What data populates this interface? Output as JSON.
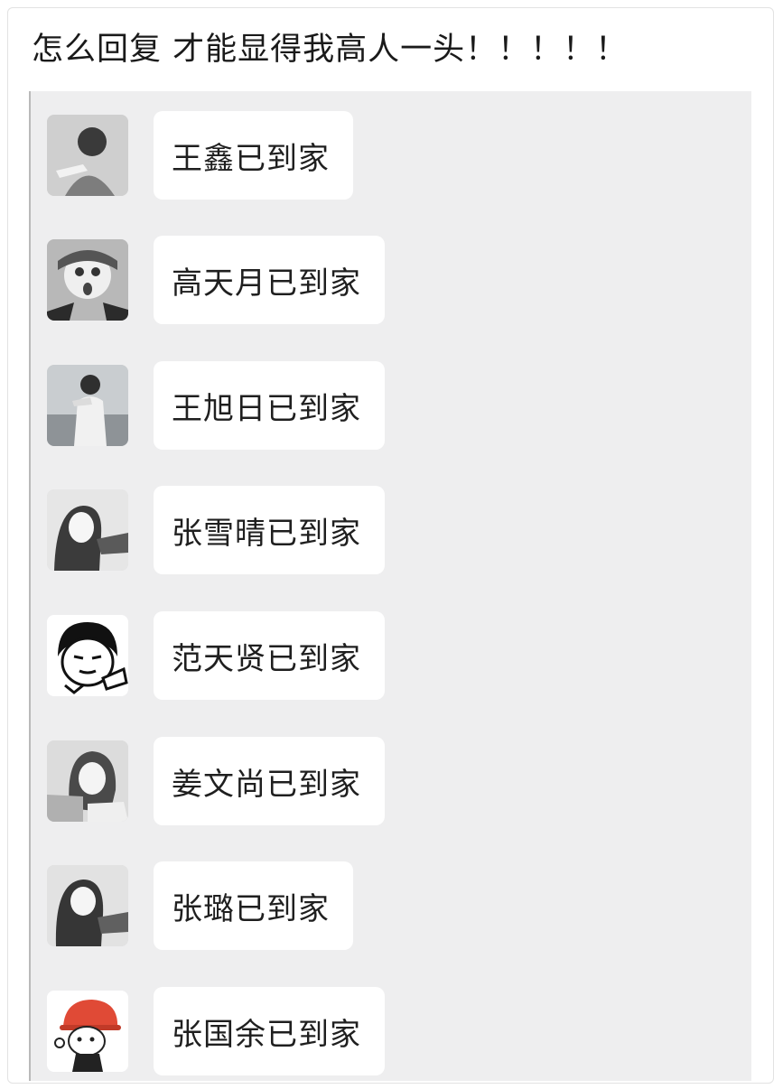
{
  "caption": "怎么回复  才能显得我高人一头！！！！！",
  "messages": [
    {
      "avatar": "photo-avatar-icon",
      "text": "王鑫已到家"
    },
    {
      "avatar": "photo-avatar-icon",
      "text": "高天月已到家"
    },
    {
      "avatar": "photo-avatar-icon",
      "text": "王旭日已到家"
    },
    {
      "avatar": "photo-avatar-icon",
      "text": "张雪晴已到家"
    },
    {
      "avatar": "cartoon-avatar-icon",
      "text": "范天贤已到家"
    },
    {
      "avatar": "photo-avatar-icon",
      "text": "姜文尚已到家"
    },
    {
      "avatar": "photo-avatar-icon",
      "text": "张璐已到家"
    },
    {
      "avatar": "cartoon-avatar-icon",
      "text": "张国余已到家"
    }
  ],
  "colors": {
    "chat_background": "#eeeeef",
    "bubble_background": "#ffffff",
    "text": "#1f1f1f"
  }
}
